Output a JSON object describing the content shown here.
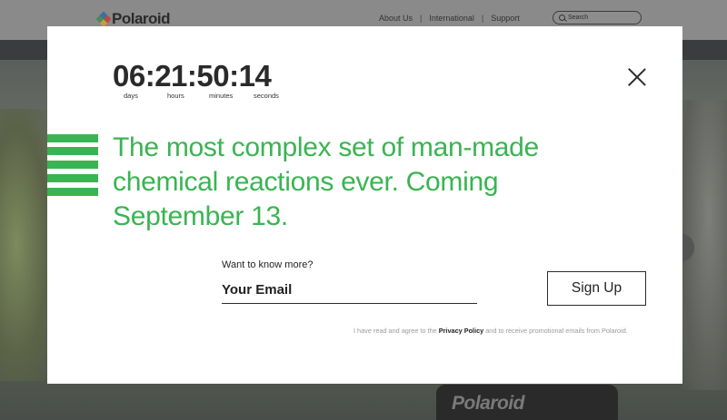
{
  "site": {
    "logo_text": "Polaroid",
    "nav": [
      "About Us",
      "International",
      "Support"
    ],
    "nav_separator": "|",
    "search_placeholder": "Search",
    "camera_brand": "Polaroid"
  },
  "modal": {
    "countdown": {
      "value": "06:21:50:14",
      "labels": [
        "days",
        "hours",
        "minutes",
        "seconds"
      ]
    },
    "headline": "The most complex set of man-made chemical reactions ever. Coming September 13.",
    "form": {
      "label": "Want to know more?",
      "email_placeholder": "Your Email",
      "signup_label": "Sign Up"
    },
    "legal": {
      "prefix": "I have read and agree to the",
      "policy_link": "Privacy Policy",
      "suffix": "and to receive promotional emails from Polaroid."
    }
  },
  "colors": {
    "accent_green": "#3ab452",
    "text_dark": "#2a2a2a",
    "overlay_gray": "#6f6f6f"
  },
  "icons": {
    "close": "close-icon",
    "search": "search-icon",
    "stripes": "stripes-graphic"
  }
}
